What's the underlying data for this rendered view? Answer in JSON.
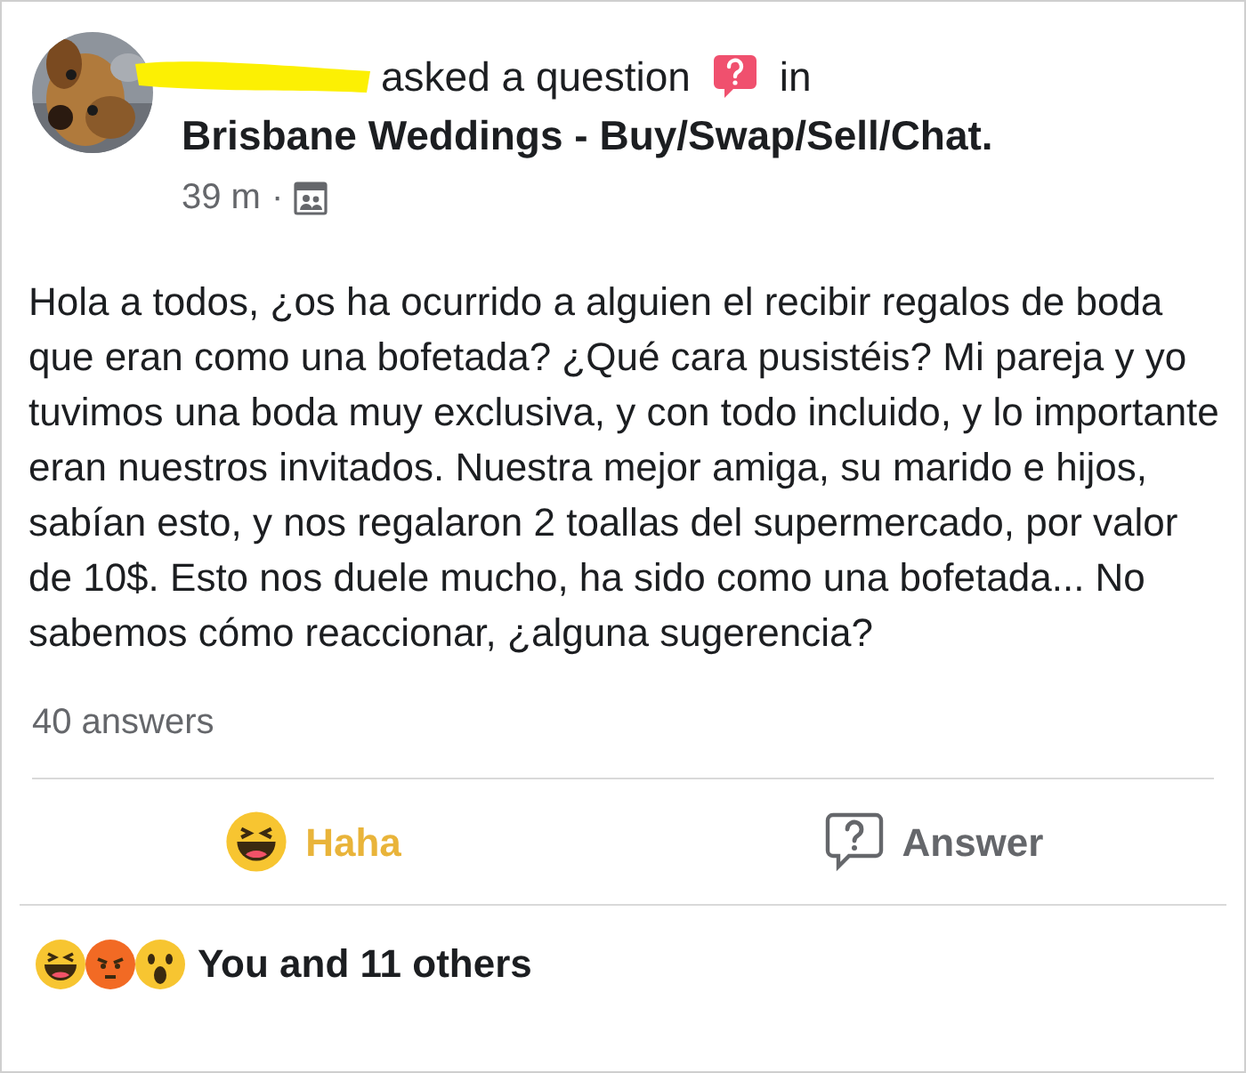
{
  "post": {
    "header_action": "asked a question",
    "header_in": "in",
    "group": "Brisbane Weddings - Buy/Swap/Sell/Chat.",
    "time": "39 m",
    "separator": "·",
    "body": "Hola a todos, ¿os ha ocurrido a alguien el recibir regalos de boda que eran como una bofetada? ¿Qué cara pusistéis? Mi pareja y yo tuvimos una boda muy exclusiva, y con todo incluido, y lo importante eran nuestros invitados. Nuestra mejor amiga, su marido e hijos, sabían esto, y nos regalaron 2 toallas del supermercado, por valor de 10$. Esto nos duele mucho, ha sido como una bofetada... No sabemos cómo reaccionar, ¿alguna sugerencia?",
    "answer_count": "40 answers"
  },
  "actions": [
    {
      "kind": "haha",
      "label": "Haha",
      "selected": true
    },
    {
      "kind": "answer",
      "label": "Answer",
      "selected": false
    }
  ],
  "reactions": {
    "icons": [
      {
        "kind": "haha"
      },
      {
        "kind": "angry"
      },
      {
        "kind": "wow"
      }
    ],
    "summary": "You and 11 others"
  }
}
